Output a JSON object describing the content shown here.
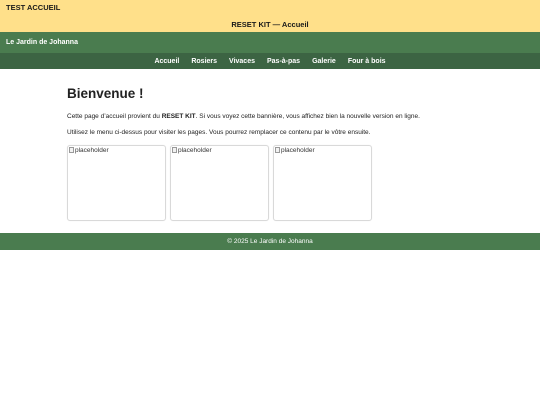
{
  "test_banner": {
    "label": "TEST ACCUEIL"
  },
  "reset_banner": {
    "label": "RESET KIT — Accueil"
  },
  "header": {
    "site_title": "Le Jardin de Johanna"
  },
  "nav": {
    "items": [
      {
        "label": "Accueil"
      },
      {
        "label": "Rosiers"
      },
      {
        "label": "Vivaces"
      },
      {
        "label": "Pas-à-pas"
      },
      {
        "label": "Galerie"
      },
      {
        "label": "Four à bois"
      }
    ]
  },
  "main": {
    "heading": "Bienvenue !",
    "intro_before": "Cette page d’accueil provient du ",
    "intro_bold": "RESET KIT",
    "intro_after": ". Si vous voyez cette bannière, vous affichez bien la nouvelle version en ligne.",
    "hint": "Utilisez le menu ci-dessus pour visiter les pages. Vous pourrez remplacer ce contenu par le vôtre ensuite.",
    "gallery": [
      {
        "alt": "placeholder"
      },
      {
        "alt": "placeholder"
      },
      {
        "alt": "placeholder"
      }
    ]
  },
  "footer": {
    "text": "© 2025 Le Jardin de Johanna"
  },
  "colors": {
    "banner_bg": "#ffe08a",
    "header_bg": "#4a7c4f",
    "nav_bg": "#3c6443",
    "footer_bg": "#4a7c4f"
  }
}
